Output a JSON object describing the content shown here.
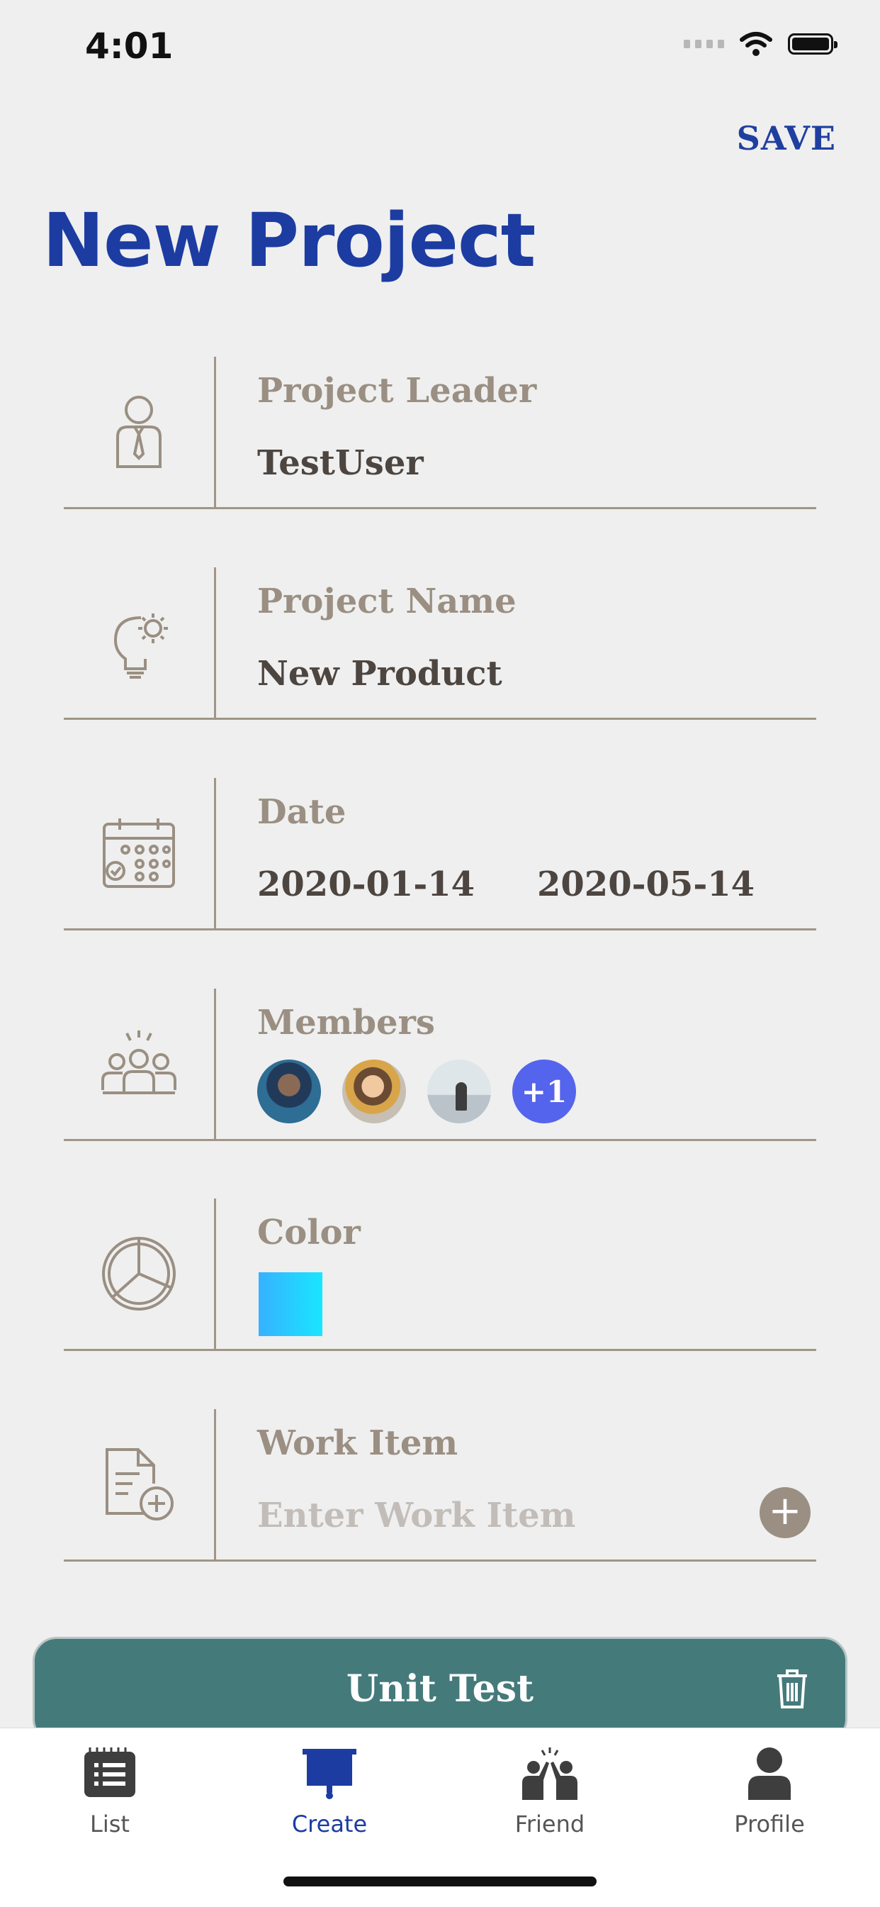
{
  "status_bar": {
    "time": "4:01"
  },
  "header": {
    "save_label": "SAVE",
    "title": "New Project"
  },
  "form": {
    "leader": {
      "label": "Project Leader",
      "value": "TestUser"
    },
    "name": {
      "label": "Project Name",
      "value": "New Product"
    },
    "date": {
      "label": "Date",
      "start": "2020-01-14",
      "end": "2020-05-14"
    },
    "members": {
      "label": "Members",
      "more_count": "+1"
    },
    "color": {
      "label": "Color",
      "swatch": "#2fc8ff"
    },
    "work_item": {
      "label": "Work Item",
      "placeholder": "Enter Work Item"
    }
  },
  "task_bar": {
    "title": "Unit Test"
  },
  "tabs": [
    {
      "label": "List",
      "icon": "list-icon"
    },
    {
      "label": "Create",
      "icon": "create-icon",
      "active": true
    },
    {
      "label": "Friend",
      "icon": "friend-icon"
    },
    {
      "label": "Profile",
      "icon": "profile-icon"
    }
  ],
  "colors": {
    "accent": "#1c3ca2",
    "teal": "#457a7b",
    "muted": "#9a8f82",
    "badge": "#5564ec"
  }
}
